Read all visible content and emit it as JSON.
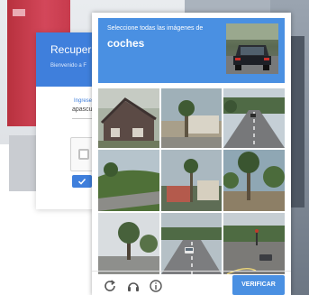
{
  "login": {
    "title": "Recuperar c",
    "subtitle": "Bienvenido a F",
    "field_label": "Ingrese",
    "field_value": "apascu",
    "submit_icon": "check-icon"
  },
  "challenge": {
    "instruction": "Seleccione todas las imágenes de",
    "target_word": "coches",
    "verify_label": "VERIFICAR",
    "footer_icons": [
      "reload-icon",
      "audio-icon",
      "info-icon"
    ],
    "tiles": [
      "house-roof-tile",
      "palm-tree-house-tile",
      "road-cars-tile",
      "grass-hill-road-tile",
      "palm-street-tile",
      "palm-trees-tile",
      "tree-road-tile",
      "intersection-car-tile",
      "street-car-tile"
    ]
  },
  "colors": {
    "challenge_blue": "#4a90e2",
    "login_blue": "#3f7fdc"
  }
}
